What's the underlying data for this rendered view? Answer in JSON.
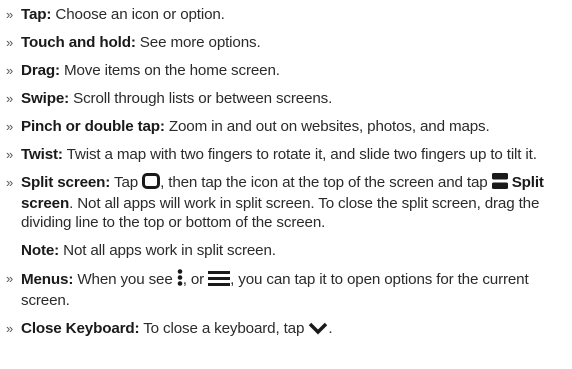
{
  "items": [
    {
      "term": "Tap:",
      "text": " Choose an icon or option."
    },
    {
      "term": "Touch and hold:",
      "text": " See more options."
    },
    {
      "term": "Drag:",
      "text": " Move items on the home screen."
    },
    {
      "term": "Swipe:",
      "text": " Scroll through lists or between screens."
    },
    {
      "term": "Pinch or double tap:",
      "text": " Zoom in and out on websites, photos, and maps."
    },
    {
      "term": "Twist:",
      "text": " Twist a map with two fingers to rotate it, and slide two fingers up to tilt it."
    }
  ],
  "split": {
    "term": "Split screen:",
    "text_a": " Tap ",
    "text_b": ", then tap the icon at the top of the screen and tap ",
    "label": "Split screen",
    "text_c": ". Not all apps will work in split screen. To close the split screen, drag the dividing line to the top or bottom of the screen."
  },
  "note": {
    "term": "Note:",
    "text": " Not all apps work in split screen."
  },
  "menus": {
    "term": "Menus:",
    "text_a": " When you see ",
    "text_b": ", or ",
    "text_c": ", you can tap it to open options for the current screen."
  },
  "keyboard": {
    "term": "Close Keyboard:",
    "text_a": " To close a keyboard, tap ",
    "text_b": "."
  },
  "bullet_glyph": "»",
  "icons": {
    "recents": "recent-apps-square-icon",
    "split": "split-screen-icon",
    "overflow": "vertical-dots-menu-icon",
    "hamburger": "hamburger-menu-icon",
    "chevron": "chevron-down-icon"
  }
}
